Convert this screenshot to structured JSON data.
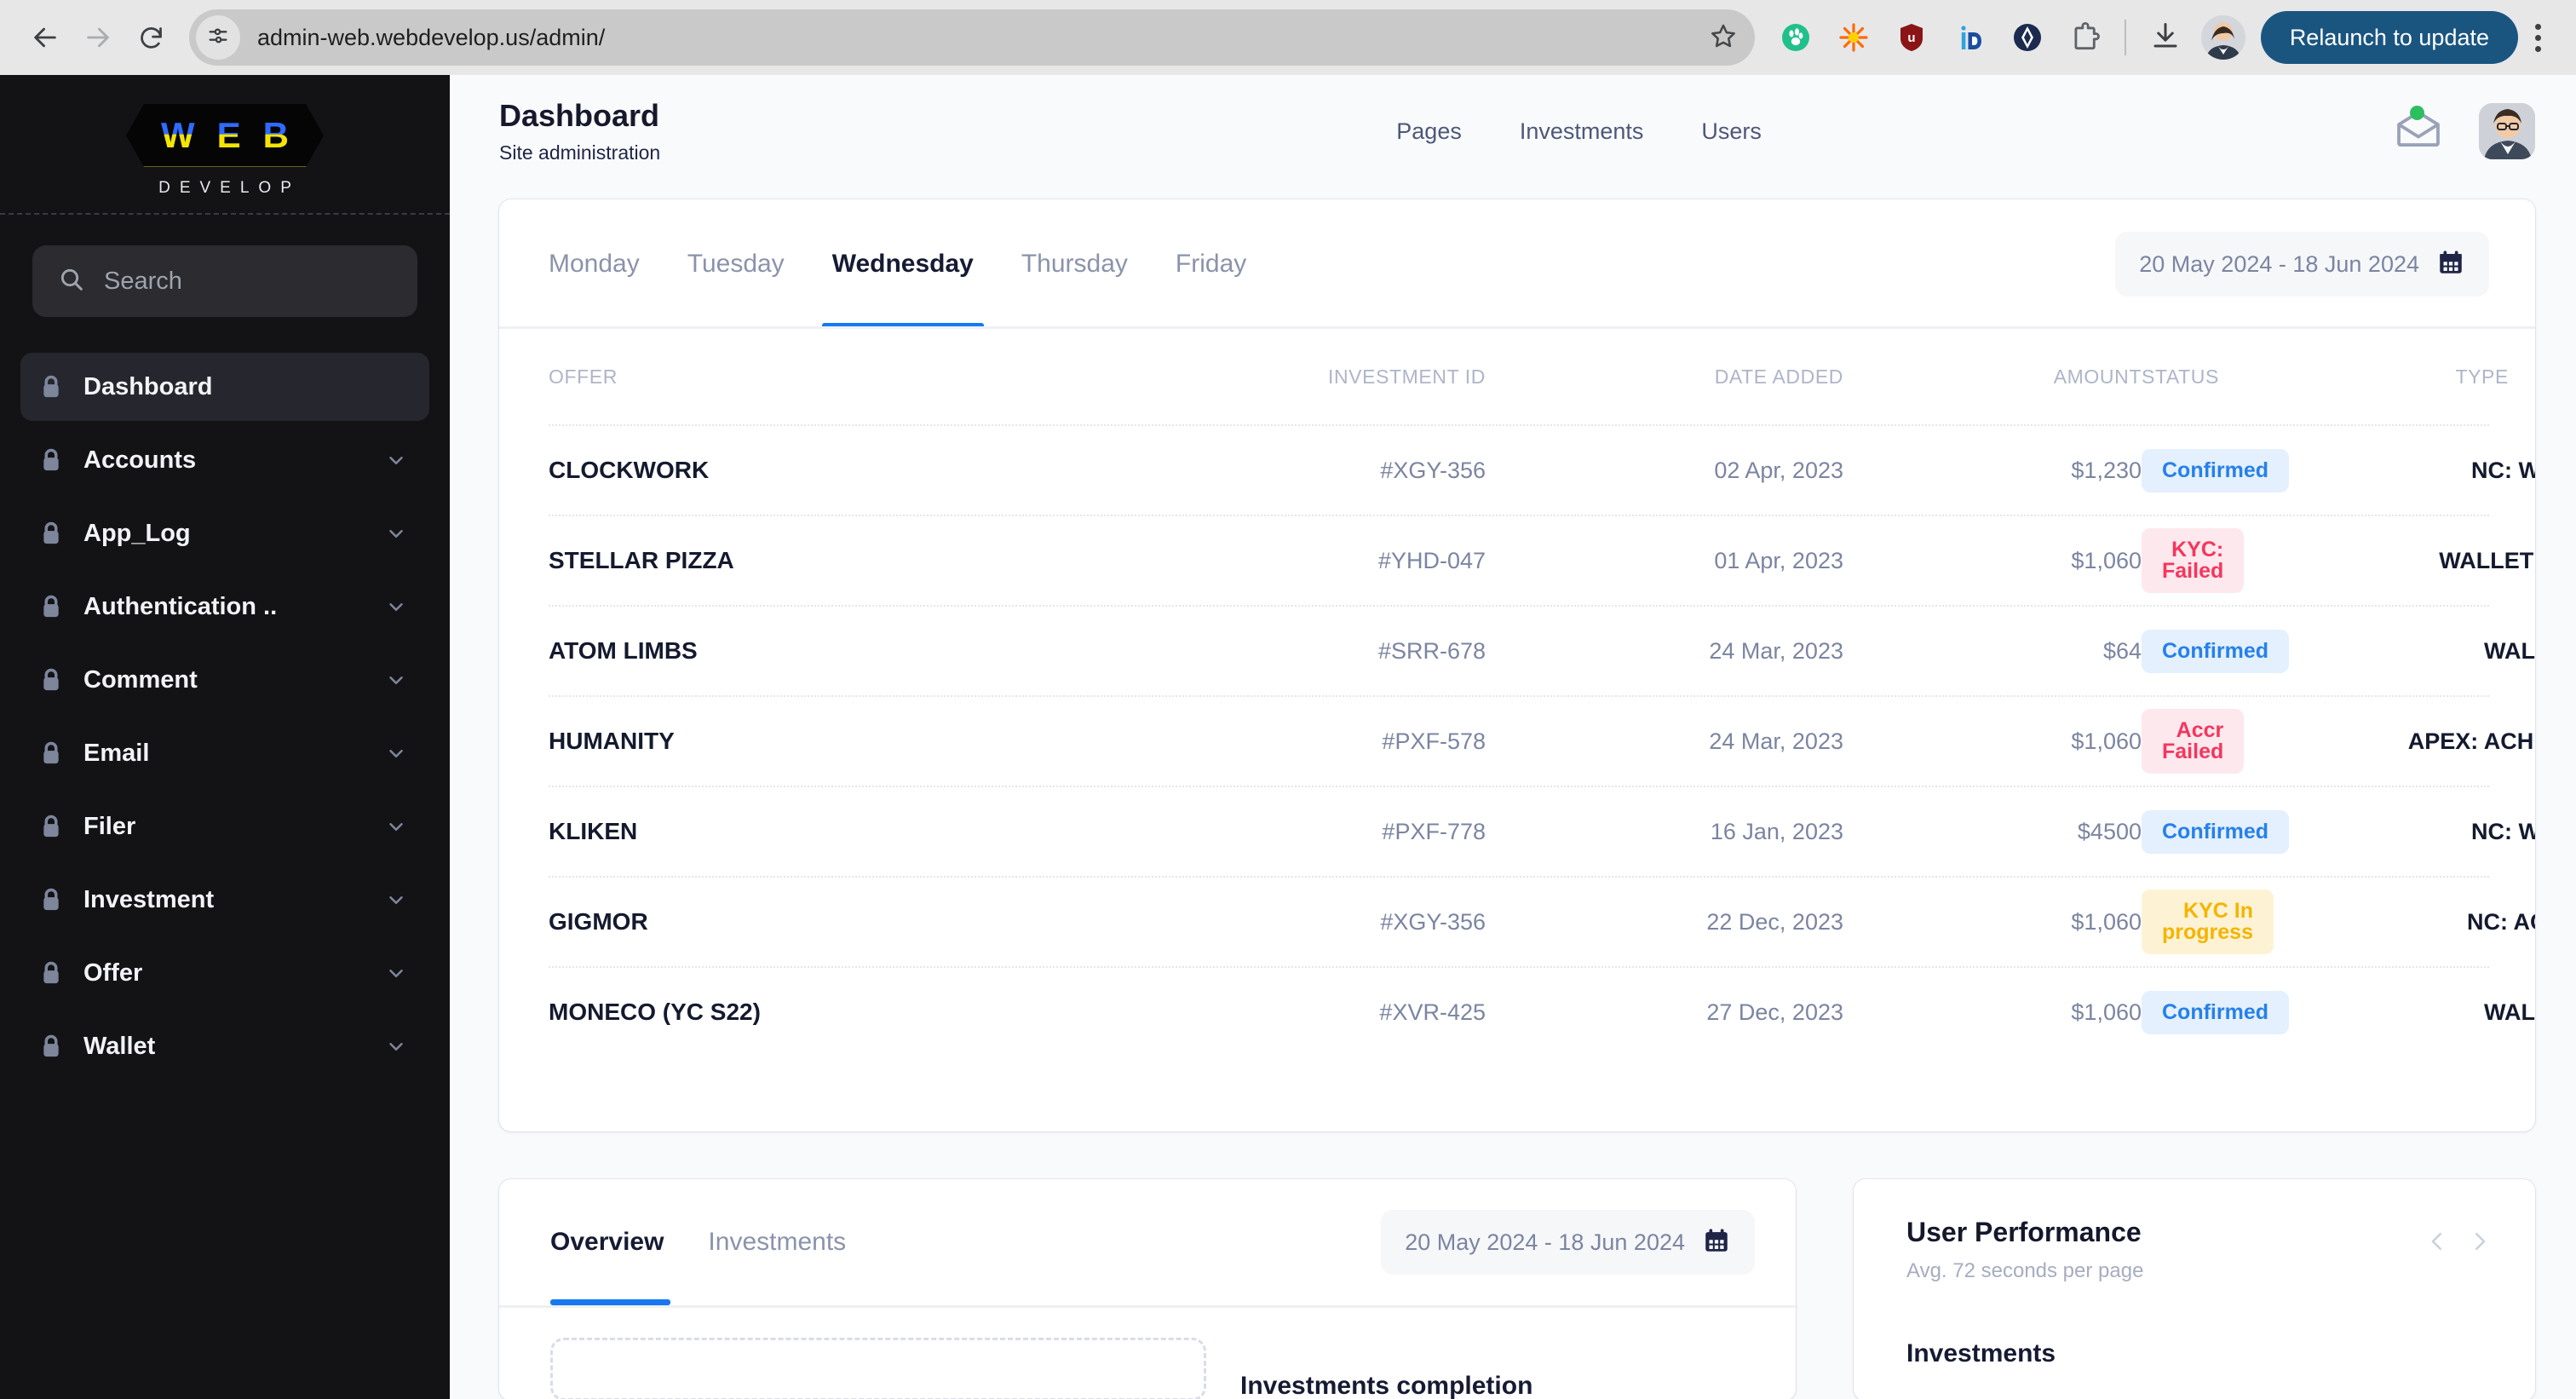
{
  "browser": {
    "back_icon": "back-arrow-icon",
    "forward_icon": "forward-arrow-icon",
    "reload_icon": "reload-icon",
    "site_info_icon": "site-settings-icon",
    "url": "admin-web.webdevelop.us/admin/",
    "bookmark_icon": "star-icon",
    "extensions": [
      {
        "name": "grammarly-extension-icon",
        "color": "#21c08b"
      },
      {
        "name": "sparkle-extension-icon",
        "color": "#ff6a00"
      },
      {
        "name": "ublock-origin-icon",
        "color": "#8a1416"
      },
      {
        "name": "id-extension-icon",
        "color": "#1273c7"
      },
      {
        "name": "diamond-extension-icon",
        "color": "#1b2a4e"
      },
      {
        "name": "puzzle-extensions-icon",
        "color": "#6b7280"
      }
    ],
    "download_icon": "download-icon",
    "profile_icon": "profile-avatar",
    "relaunch_label": "Relaunch to update",
    "menu_icon": "kebab-menu-icon"
  },
  "sidebar": {
    "logo": {
      "word": "WEB",
      "letters": [
        "W",
        "E",
        "B"
      ],
      "subtitle": "DEVELOP",
      "color_top": "#2f6bff",
      "color_bottom": "#f5e400"
    },
    "search": {
      "placeholder": "Search",
      "icon": "search-icon"
    },
    "items": [
      {
        "label": "Dashboard",
        "icon": "lock-icon",
        "active": true,
        "chevron": false
      },
      {
        "label": "Accounts",
        "icon": "lock-icon",
        "active": false,
        "chevron": true
      },
      {
        "label": "App_Log",
        "icon": "lock-icon",
        "active": false,
        "chevron": true
      },
      {
        "label": "Authentication ..",
        "icon": "lock-icon",
        "active": false,
        "chevron": true
      },
      {
        "label": "Comment",
        "icon": "lock-icon",
        "active": false,
        "chevron": true
      },
      {
        "label": "Email",
        "icon": "lock-icon",
        "active": false,
        "chevron": true
      },
      {
        "label": "Filer",
        "icon": "lock-icon",
        "active": false,
        "chevron": true
      },
      {
        "label": "Investment",
        "icon": "lock-icon",
        "active": false,
        "chevron": true
      },
      {
        "label": "Offer",
        "icon": "lock-icon",
        "active": false,
        "chevron": true
      },
      {
        "label": "Wallet",
        "icon": "lock-icon",
        "active": false,
        "chevron": true
      }
    ]
  },
  "header": {
    "title": "Dashboard",
    "subtitle": "Site administration",
    "nav": [
      {
        "label": "Pages"
      },
      {
        "label": "Investments"
      },
      {
        "label": "Users"
      }
    ],
    "mail_icon": "envelope-icon",
    "notification_dot_color": "#2dbe60",
    "avatar": "user-avatar"
  },
  "table_card": {
    "day_tabs": [
      {
        "label": "Monday",
        "active": false
      },
      {
        "label": "Tuesday",
        "active": false
      },
      {
        "label": "Wednesday",
        "active": true
      },
      {
        "label": "Thursday",
        "active": false
      },
      {
        "label": "Friday",
        "active": false
      }
    ],
    "date_range": {
      "value": "20 May 2024 - 18 Jun 2024",
      "icon": "calendar-icon"
    },
    "columns": [
      "OFFER",
      "INVESTMENT ID",
      "DATE ADDED",
      "AMOUNT",
      "STATUS",
      "TYPE"
    ],
    "rows": [
      {
        "offer": "CLOCKWORK",
        "id": "#XGY-356",
        "date": "02 Apr, 2023",
        "amount": "$1,230",
        "status": "Confirmed",
        "status_kind": "blue",
        "type": "NC: WIRE"
      },
      {
        "offer": "STELLAR PIZZA",
        "id": "#YHD-047",
        "date": "01 Apr, 2023",
        "amount": "$1,060",
        "status": "KYC: Failed",
        "status_kind": "red",
        "type": "WALLET"
      },
      {
        "offer": "ATOM LIMBS",
        "id": "#SRR-678",
        "date": "24 Mar, 2023",
        "amount": "$64",
        "status": "Confirmed",
        "status_kind": "blue",
        "type": "WALLET"
      },
      {
        "offer": "HUMANITY",
        "id": "#PXF-578",
        "date": "24 Mar, 2023",
        "amount": "$1,060",
        "status": "Accr Failed",
        "status_kind": "red",
        "type": "APEX: ACH"
      },
      {
        "offer": "KLIKEN",
        "id": "#PXF-778",
        "date": "16 Jan, 2023",
        "amount": "$4500",
        "status": "Confirmed",
        "status_kind": "blue",
        "type": "NC: WIRE"
      },
      {
        "offer": "GIGMOR",
        "id": "#XGY-356",
        "date": "22 Dec, 2023",
        "amount": "$1,060",
        "status": "KYC In progress",
        "status_kind": "yellow",
        "type": "NC: ACH"
      },
      {
        "offer": "MONECO (YC S22)",
        "id": "#XVR-425",
        "date": "27 Dec, 2023",
        "amount": "$1,060",
        "status": "Confirmed",
        "status_kind": "blue",
        "type": "WALLET"
      }
    ],
    "status_colors": {
      "blue": {
        "bg": "#e4f0fd",
        "fg": "#2680eb"
      },
      "red": {
        "bg": "#fde8ee",
        "fg": "#f5365c"
      },
      "yellow": {
        "bg": "#fdf3d4",
        "fg": "#f5b400"
      }
    }
  },
  "overview_card": {
    "tabs": [
      {
        "label": "Overview",
        "active": true
      },
      {
        "label": "Investments",
        "active": false
      }
    ],
    "date_range": {
      "value": "20 May 2024 - 18 Jun 2024",
      "icon": "calendar-icon"
    },
    "chart_title": "Investments completion"
  },
  "performance_card": {
    "title": "User Performance",
    "subtitle": "Avg. 72 seconds per page",
    "prev_icon": "chevron-left-icon",
    "next_icon": "chevron-right-icon",
    "section_label": "Investments"
  }
}
